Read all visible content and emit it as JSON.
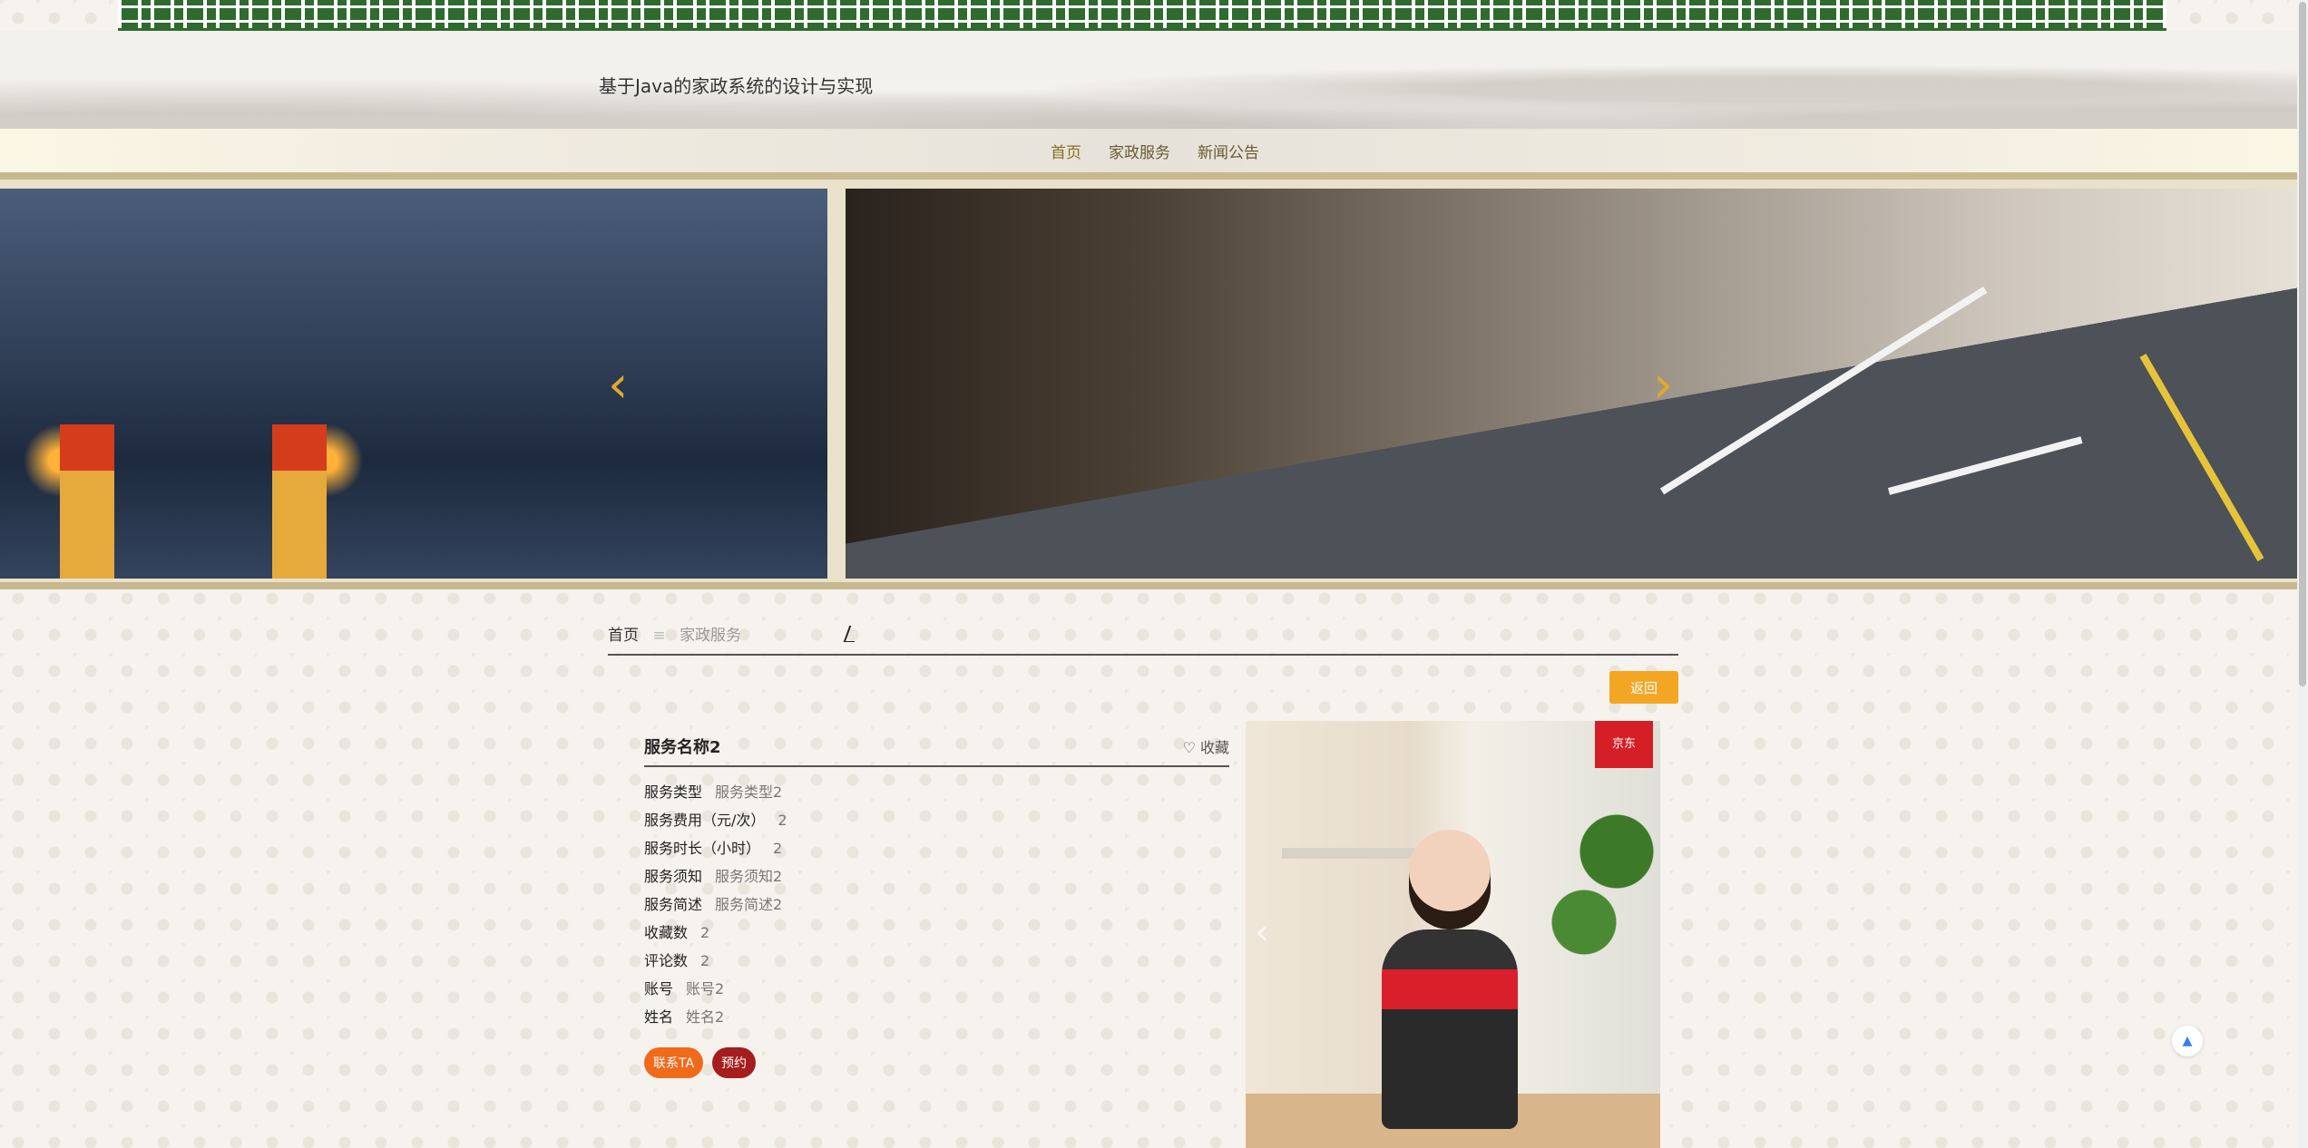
{
  "site": {
    "title": "基于Java的家政系统的设计与实现"
  },
  "nav": {
    "items": [
      "首页",
      "家政服务",
      "新闻公告"
    ]
  },
  "banner": {
    "prev_icon": "chevron-left-icon",
    "next_icon": "chevron-right-icon"
  },
  "breadcrumb": {
    "home": "首页",
    "separator": "≡",
    "current": "家政服务"
  },
  "actions": {
    "back": "返回"
  },
  "detail": {
    "title": "服务名称2",
    "favorite_label": "♡ 收藏",
    "fields": [
      {
        "label": "服务类型",
        "value": "服务类型2"
      },
      {
        "label": "服务费用（元/次）",
        "value": "2"
      },
      {
        "label": "服务时长（小时）",
        "value": "2"
      },
      {
        "label": "服务须知",
        "value": "服务须知2"
      },
      {
        "label": "服务简述",
        "value": "服务简述2"
      },
      {
        "label": "收藏数",
        "value": "2"
      },
      {
        "label": "评论数",
        "value": "2"
      },
      {
        "label": "账号",
        "value": "账号2"
      },
      {
        "label": "姓名",
        "value": "姓名2"
      }
    ],
    "buttons": {
      "contact": "联系TA",
      "book": "预约"
    }
  },
  "photo": {
    "brand_logo": "京东"
  },
  "colors": {
    "accent": "#f3a623",
    "nav_text": "#8a6d1c",
    "contact": "#f06a1a",
    "book": "#a51d1d",
    "top_band": "#2f6b2e"
  }
}
